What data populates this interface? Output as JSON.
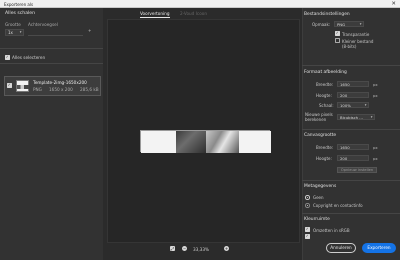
{
  "window": {
    "title": "Exporteren als",
    "close_glyph": "✕"
  },
  "left": {
    "section_title": "Alles schalen",
    "size_label": "Grootte",
    "suffix_label": "Achtervoegsel",
    "size_value": "1x",
    "add_glyph": "+",
    "select_all_label": "Alles selecteren",
    "files": [
      {
        "name": "Template-2img-1650x200",
        "format": "PNG",
        "dimensions": "1650 x 200",
        "filesize": "285,6 kB"
      }
    ]
  },
  "center": {
    "tabs": [
      "Voorvertoning",
      "2-Voud Icoon"
    ],
    "zoom": "33,33%",
    "minus_glyph": "−",
    "plus_glyph": "+"
  },
  "right": {
    "file_settings": {
      "title": "Bestandsinstellingen",
      "format_label": "Opmaak:",
      "format_value": "PNG",
      "transparency_label": "Transparantie",
      "smaller_file_label": "Kleiner bestand",
      "smaller_file_sub": "(8-bits)"
    },
    "image_size": {
      "title": "Formaat afbeelding",
      "width_label": "Breedte:",
      "width_value": "1650",
      "height_label": "Hoogte:",
      "height_value": "200",
      "scale_label": "Schaal:",
      "scale_value": "100%",
      "resample_label": "Nieuwe pixels berekenen",
      "resample_value": "Bicubisch ...",
      "unit": "px"
    },
    "canvas_size": {
      "title": "Canvasgrootte",
      "width_label": "Breedte:",
      "width_value": "1650",
      "height_label": "Hoogte:",
      "height_value": "200",
      "reset_label": "Opnieuw instellen"
    },
    "metadata": {
      "title": "Metagegevens",
      "none_label": "Geen",
      "copyright_label": "Copyright en contactinfo"
    },
    "color_space": {
      "title": "Kleurruimte",
      "convert_label": "Omzetten in sRGB"
    }
  },
  "footer": {
    "cancel_label": "Annuleren",
    "export_label": "Exporteren"
  }
}
